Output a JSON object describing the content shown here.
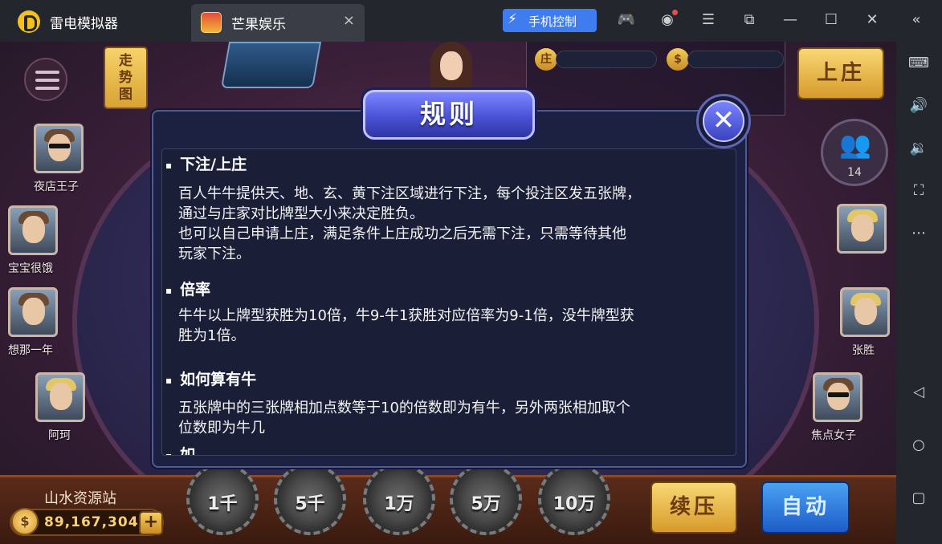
{
  "emulator": {
    "app_name": "雷电模拟器",
    "tab_title": "芒果娱乐",
    "tab_close": "×",
    "phone_control": "手机控制",
    "accent": "#3f7cf0"
  },
  "game": {
    "trend_label": "走\n势\n图",
    "become_dealer": "上庄",
    "dealer_tag": "庄",
    "players_count": "14",
    "left_players": [
      "夜店王子",
      "宝宝很饿",
      "想那一年",
      "阿珂"
    ],
    "right_players": [
      "张胜",
      "焦点女子"
    ],
    "site_name": "山水资源站",
    "coin_value": "89,167,304",
    "plus": "+",
    "chips": [
      "1千",
      "5千",
      "1万",
      "5万",
      "10万"
    ],
    "rebet": "续压",
    "auto": "自动"
  },
  "dialog": {
    "title": "规则",
    "close": "✕",
    "sections": [
      {
        "title": "下注/上庄",
        "body": "百人牛牛提供天、地、玄、黄下注区域进行下注，每个投注区发五张牌，\n通过与庄家对比牌型大小来决定胜负。\n也可以自己申请上庄，满足条件上庄成功之后无需下注，只需等待其他\n玩家下注。"
      },
      {
        "title": "倍率",
        "body": "牛牛以上牌型获胜为10倍，牛9-牛1获胜对应倍率为9-1倍，没牛牌型获\n胜为1倍。"
      },
      {
        "title": "如何算有牛",
        "body": "五张牌中的三张牌相加点数等于10的倍数即为有牛，另外两张相加取个\n位数即为牛几"
      },
      {
        "title": "如"
      }
    ]
  }
}
